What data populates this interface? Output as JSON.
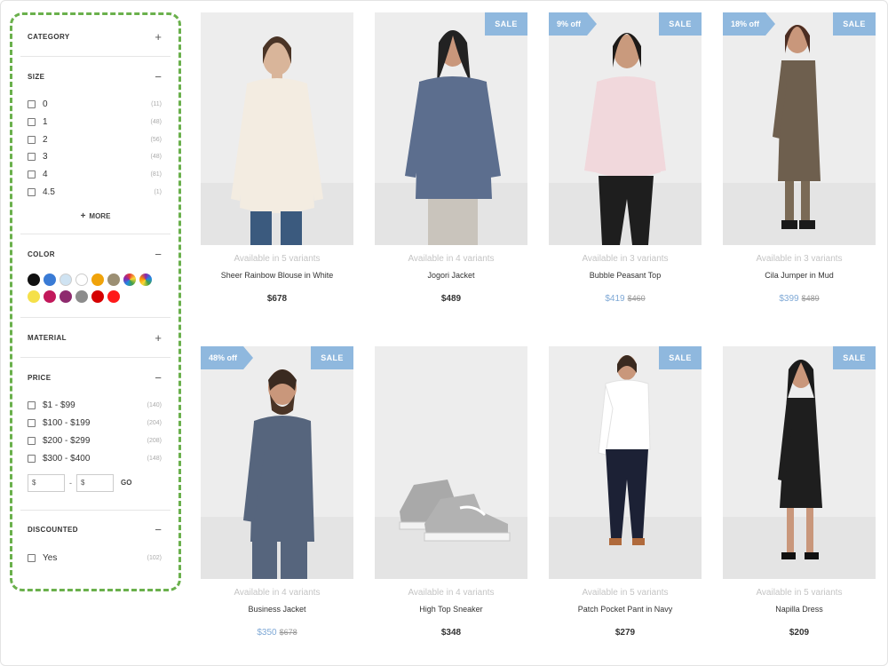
{
  "filters": {
    "category": {
      "title": "CATEGORY",
      "toggle": "+"
    },
    "size": {
      "title": "SIZE",
      "toggle": "−",
      "options": [
        {
          "label": "0",
          "count": "(11)"
        },
        {
          "label": "1",
          "count": "(48)"
        },
        {
          "label": "2",
          "count": "(56)"
        },
        {
          "label": "3",
          "count": "(48)"
        },
        {
          "label": "4",
          "count": "(81)"
        },
        {
          "label": "4.5",
          "count": "(1)"
        }
      ],
      "more_label": "MORE"
    },
    "color": {
      "title": "COLOR",
      "toggle": "−",
      "swatches": [
        "#111111",
        "#3a7bd5",
        "#cfe3f2",
        "#ffffff",
        "#f0a30a",
        "#9c8f73",
        "#rainbow",
        "#multi",
        "#f5e04a",
        "#c2185b",
        "#8e2a6e",
        "#8c8c8c",
        "#d50000",
        "#ff1a1a"
      ]
    },
    "material": {
      "title": "MATERIAL",
      "toggle": "+"
    },
    "price": {
      "title": "PRICE",
      "toggle": "−",
      "options": [
        {
          "label": "$1 - $99",
          "count": "(140)"
        },
        {
          "label": "$100 - $199",
          "count": "(204)"
        },
        {
          "label": "$200 - $299",
          "count": "(208)"
        },
        {
          "label": "$300 - $400",
          "count": "(148)"
        }
      ],
      "min_value": "$",
      "max_value": "$",
      "range_sep": "-",
      "go_label": "GO"
    },
    "discounted": {
      "title": "DISCOUNTED",
      "toggle": "−",
      "options": [
        {
          "label": "Yes",
          "count": "(102)"
        }
      ]
    }
  },
  "products": [
    {
      "name": "Sheer Rainbow Blouse in White",
      "variants": "Available in 5 variants",
      "price": "$678",
      "old_price": "",
      "sale_badge": "",
      "discount_badge": ""
    },
    {
      "name": "Jogori Jacket",
      "variants": "Available in 4 variants",
      "price": "$489",
      "old_price": "",
      "sale_badge": "SALE",
      "discount_badge": ""
    },
    {
      "name": "Bubble Peasant Top",
      "variants": "Available in 3 variants",
      "price": "$419",
      "old_price": "$460",
      "sale_badge": "SALE",
      "discount_badge": "9% off"
    },
    {
      "name": "Cila Jumper in Mud",
      "variants": "Available in 3 variants",
      "price": "$399",
      "old_price": "$489",
      "sale_badge": "SALE",
      "discount_badge": "18% off"
    },
    {
      "name": "Business Jacket",
      "variants": "Available in 4 variants",
      "price": "$350",
      "old_price": "$678",
      "sale_badge": "SALE",
      "discount_badge": "48% off"
    },
    {
      "name": "High Top Sneaker",
      "variants": "Available in 4 variants",
      "price": "$348",
      "old_price": "",
      "sale_badge": "",
      "discount_badge": ""
    },
    {
      "name": "Patch Pocket Pant in Navy",
      "variants": "Available in 5 variants",
      "price": "$279",
      "old_price": "",
      "sale_badge": "SALE",
      "discount_badge": ""
    },
    {
      "name": "Napilla Dress",
      "variants": "Available in 5 variants",
      "price": "$209",
      "old_price": "",
      "sale_badge": "SALE",
      "discount_badge": ""
    }
  ]
}
